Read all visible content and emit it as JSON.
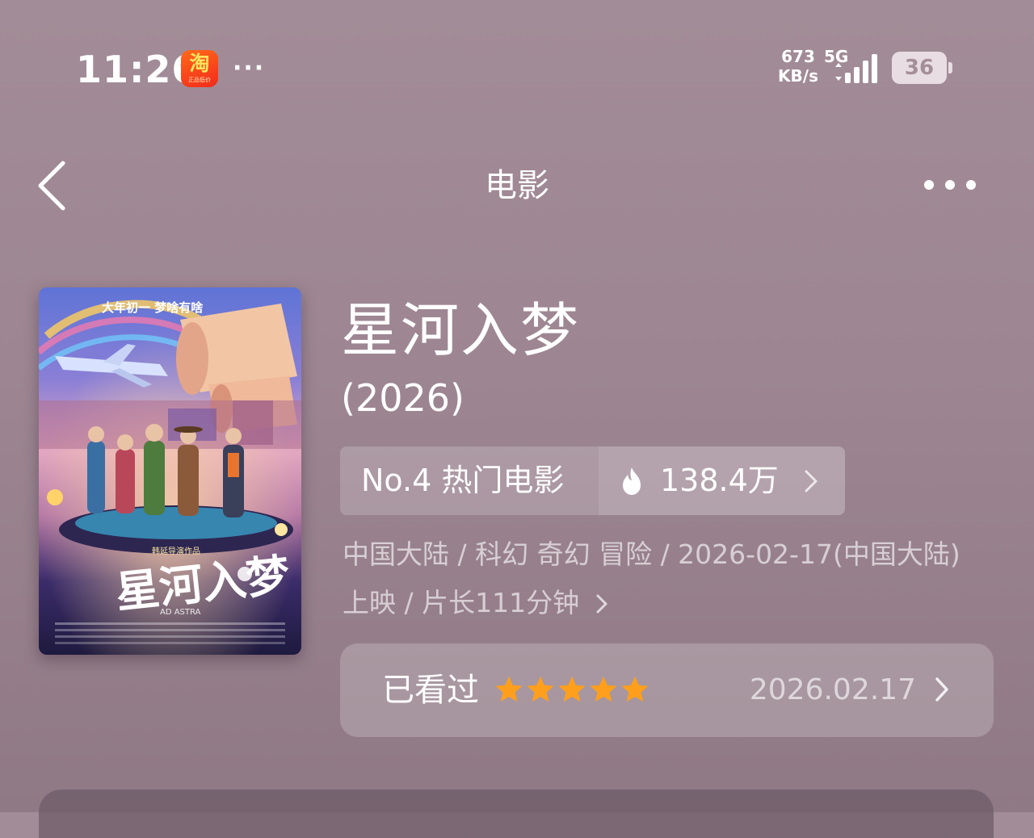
{
  "status_bar": {
    "time": "11:26",
    "app_icon": {
      "name": "taobao-icon",
      "glyph": "淘",
      "subtext": "正品低价"
    },
    "more": "···",
    "net_speed_value": "673",
    "net_speed_unit": "KB/s",
    "network_type": "5G",
    "battery_level": "36"
  },
  "header": {
    "title": "电影",
    "back_icon": "chevron-left-icon",
    "more_icon": "more-horizontal-icon"
  },
  "poster": {
    "top_text": "大年初一 梦啥有啥",
    "director_line": "韩延导演作品",
    "title_art": "星河入梦",
    "english_title": "AD ASTRA"
  },
  "movie": {
    "title": "星河入梦",
    "year": "(2026)",
    "rank_label": "No.4 热门电影",
    "hot_value": "138.4万",
    "meta_line1": "中国大陆 / 科幻 奇幻 冒险 / 2026-02-17(中国大陆)",
    "meta_line2": "上映 / 片长111分钟"
  },
  "watched": {
    "label": "已看过",
    "rating": 5,
    "rating_max": 5,
    "date": "2026.02.17"
  },
  "colors": {
    "background": "#a08a95",
    "star": "#ff9f1c",
    "app_icon_bg": "#f2451b"
  }
}
